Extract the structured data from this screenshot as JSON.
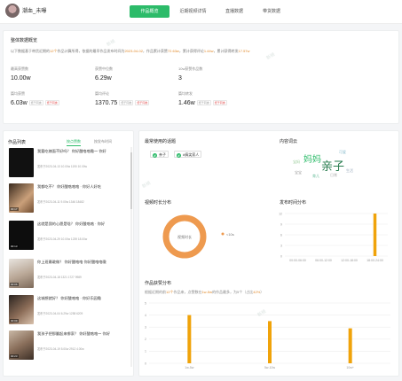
{
  "header": {
    "username": "潮血_未曝",
    "tabs": [
      "作品概览",
      "近期视频详情",
      "直播数据",
      "带货数据"
    ]
  },
  "overview": {
    "title": "整体数据概览",
    "desc_prefix": "以下数据基于带货近期的",
    "count": "12个",
    "desc_mid": "作品计算所得，依据的最早作品发布时间为",
    "date": "2023-04-02",
    "desc_a": "，作品累计获赞",
    "likes_total": "72.63w",
    "desc_b": "，累计获得评论",
    "comments_total": "1.44w",
    "desc_c": "，累计获得转发",
    "shares_total": "17.57w",
    "stats": [
      {
        "label": "最高获赞数",
        "value": "10.00w"
      },
      {
        "label": "获赞中位数",
        "value": "6.29w"
      },
      {
        "label": "10w获赞作品数",
        "value": "3"
      },
      {
        "label": "篇均获赞",
        "value": "6.03w",
        "tag1": "低于同类",
        "tag2": "低于同类"
      },
      {
        "label": "篇均评论",
        "value": "1370.75",
        "tag1": "低于同类",
        "tag2": "低于同类"
      },
      {
        "label": "篇均转发",
        "value": "1.46w",
        "tag1": "低于同类",
        "tag2": "低于同类"
      }
    ]
  },
  "works": {
    "title": "作品列表",
    "filters": [
      "按点赞数",
      "按发布时间"
    ],
    "items": [
      {
        "title": "我要吃辣面不好吗？ 你好酸咯咯嗷～ 你好",
        "meta": "发布于2023-04-13  10.00w  1190  10.00w",
        "dur": ""
      },
      {
        "title": "我都吃不？ 你好酸咯咯咯 · 你好人好吃",
        "meta": "发布于2023-04-11  9.00w  1346  18482",
        "dur": "00:17"
      },
      {
        "title": "这就是我的心愿是啥？ 你好酸咯咯 · 你好",
        "meta": "发布于2023-04-29  10.00w  1239  18.00w",
        "dur": "00:13"
      },
      {
        "title": "你上班最敢做？ 你好酸咯咯 你好酸咯咯嗷",
        "meta": "发布于2023-04-18  1321  1727  9989",
        "dur": "00:06"
      },
      {
        "title": "这城想就好？ 你好酸咯咯 · 你好乐园嗷",
        "meta": "发布于2023-04-04  6.29w  1258  6209",
        "dur": "00:09"
      },
      {
        "title": "我孩子把那翻起来哪家？ 你好酸咯咯～ 你好",
        "meta": "发布于2023-04-19  5.00w  2912  4.00w",
        "dur": "00:23"
      }
    ]
  },
  "topics": {
    "title": "最常使用的话题",
    "chips": [
      "亲子",
      "#搞笑家人"
    ]
  },
  "cloud": {
    "title": "内容词云",
    "words": [
      "妈妈",
      "亲子",
      "宝宝",
      "育儿",
      "日常",
      "可爱",
      "生活",
      "宝妈"
    ]
  },
  "duration": {
    "title": "视频时长分布",
    "center": "视频时长",
    "legend": "<10s"
  },
  "publish": {
    "title": "发布时间分布"
  },
  "likes": {
    "title": "作品获赞分布",
    "desc_prefix": "根据近期的前",
    "count": "12个",
    "desc_mid": "作品来，点赞数在",
    "range": "1w-5w",
    "desc_tail": "的作品最多，为5个（占比",
    "pct": "42%",
    "desc_end": "）"
  },
  "chart_data": [
    {
      "type": "bar",
      "title": "发布时间分布",
      "categories": [
        "00:00-06:00",
        "06:00-12:00",
        "12:00-18:00",
        "18:00-24:00"
      ],
      "values": [
        0,
        0,
        0,
        12
      ],
      "ylim": [
        0,
        12
      ],
      "yticks": [
        0,
        3,
        6,
        9,
        12
      ]
    },
    {
      "type": "bar",
      "title": "作品获赞分布",
      "categories": [
        "1w-5w",
        "5w-10w",
        "10w+"
      ],
      "values": [
        4,
        3.5,
        2.9
      ],
      "ylim": [
        0,
        5
      ],
      "yticks": [
        0,
        1,
        2,
        3,
        4,
        5
      ]
    },
    {
      "type": "pie",
      "title": "视频时长分布",
      "categories": [
        "<10s"
      ],
      "values": [
        100
      ]
    }
  ],
  "colors": {
    "accent": "#2cbb69",
    "bar": "#f0a30a",
    "donut": "#ee9a4f",
    "red": "#e14b4b"
  }
}
